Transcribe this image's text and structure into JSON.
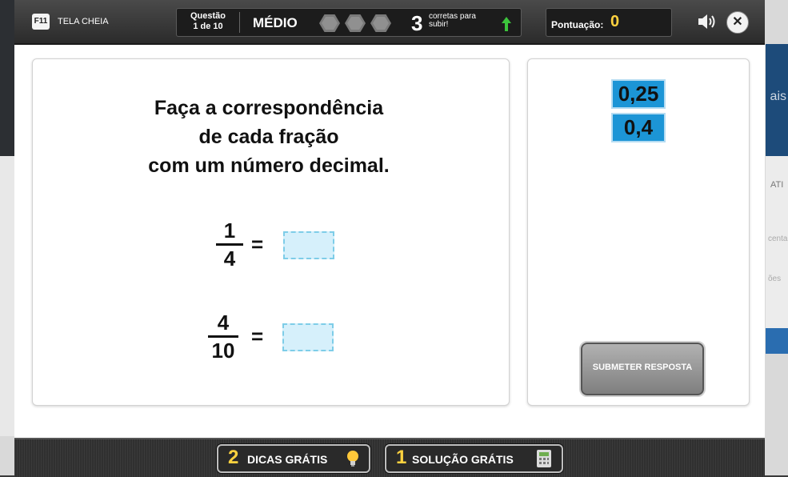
{
  "header": {
    "fullscreen_key": "F11",
    "fullscreen_label": "TELA CHEIA",
    "question_word": "Questão",
    "question_progress": "1 de 10",
    "level": "MÉDIO",
    "level_steps_total": 3,
    "level_steps_filled": 0,
    "correct_count": "3",
    "correct_text": "corretas para subir!",
    "score_label": "Pontuação:",
    "score_value": "0"
  },
  "question": {
    "instruction_lines": [
      "Faça a correspondência",
      "de cada fração",
      "com um número decimal."
    ],
    "fractions": [
      {
        "numerator": "1",
        "denominator": "4",
        "equals": "="
      },
      {
        "numerator": "4",
        "denominator": "10",
        "equals": "="
      }
    ]
  },
  "answers": {
    "tiles": [
      "0,25",
      "0,4"
    ],
    "submit_label": "SUBMETER RESPOSTA"
  },
  "footer": {
    "hints_count": "2",
    "hints_label": "DICAS GRÁTIS",
    "solution_count": "1",
    "solution_label": "SOLUÇÃO GRÁTIS"
  },
  "background": {
    "right_text": "ais",
    "right_label": "ATI",
    "right_text2": "centa",
    "right_text3": "ões"
  },
  "colors": {
    "accent_yellow": "#ffd23f",
    "tile_blue": "#1c95d6",
    "drop_bg": "#d6f0fb",
    "up_arrow": "#3cc43c"
  }
}
